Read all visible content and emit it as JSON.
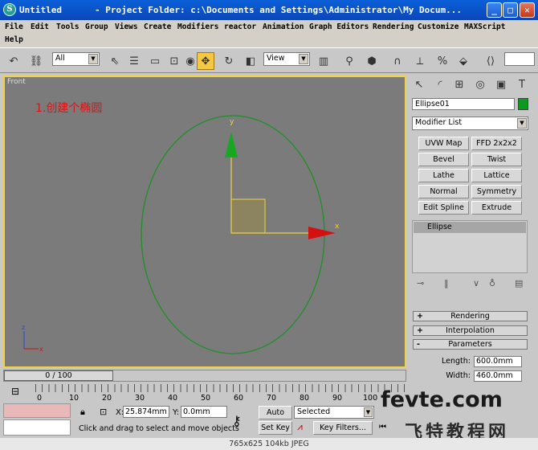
{
  "window": {
    "title": "Untitled",
    "path": "- Project Folder: c:\\Documents and Settings\\Administrator\\My Docum...",
    "minimize_glyph": "_",
    "maximize_glyph": "□",
    "close_glyph": "✕"
  },
  "menu": {
    "row1": [
      "File",
      "Edit",
      "Tools",
      "Group",
      "Views",
      "Create",
      "Modifiers",
      "reactor",
      "Animation",
      "Graph Editors",
      "Rendering",
      "Customize",
      "MAXScript"
    ],
    "row2": [
      "Help"
    ]
  },
  "toolbar": {
    "selection_filter": "All",
    "reference_coord": "View"
  },
  "viewport": {
    "label": "Front",
    "note": "1.创建个椭圆",
    "axis_y": "y",
    "axis_x": "x",
    "mini_axis_z": "z",
    "mini_axis_x": "x",
    "ellipse_color": "#1f8f2a",
    "border_color": "#f0d23a"
  },
  "command_panel": {
    "object_name": "Ellipse01",
    "object_color": "#0a9a1e",
    "modifier_list": "Modifier List",
    "modifier_buttons": [
      "UVW Map",
      "FFD 2x2x2",
      "Bevel",
      "Twist",
      "Lathe",
      "Lattice",
      "Normal",
      "Symmetry",
      "Edit Spline",
      "Extrude"
    ],
    "stack_item": "Ellipse",
    "rollouts": [
      {
        "sign": "+",
        "label": "Rendering"
      },
      {
        "sign": "+",
        "label": "Interpolation"
      },
      {
        "sign": "-",
        "label": "Parameters"
      }
    ],
    "params": [
      {
        "label": "Length:",
        "value": "600.0mm"
      },
      {
        "label": "Width:",
        "value": "460.0mm"
      }
    ]
  },
  "timeline": {
    "frame_display": "0 / 100",
    "ticks": [
      "0",
      "10",
      "20",
      "30",
      "40",
      "50",
      "60",
      "70",
      "80",
      "90",
      "100"
    ]
  },
  "status": {
    "prompt": "Click and drag to select and move objects",
    "x_label": "X:",
    "x_value": "25.874mm",
    "y_label": "Y:",
    "y_value": "0.0mm",
    "auto_key": "Auto Key",
    "set_key": "Set Key",
    "key_mode": "Selected",
    "key_filters": "Key Filters..."
  },
  "watermark": {
    "line1": "fevte.com",
    "line2": "飞特教程网"
  },
  "caption": "765x625  104kb  JPEG"
}
